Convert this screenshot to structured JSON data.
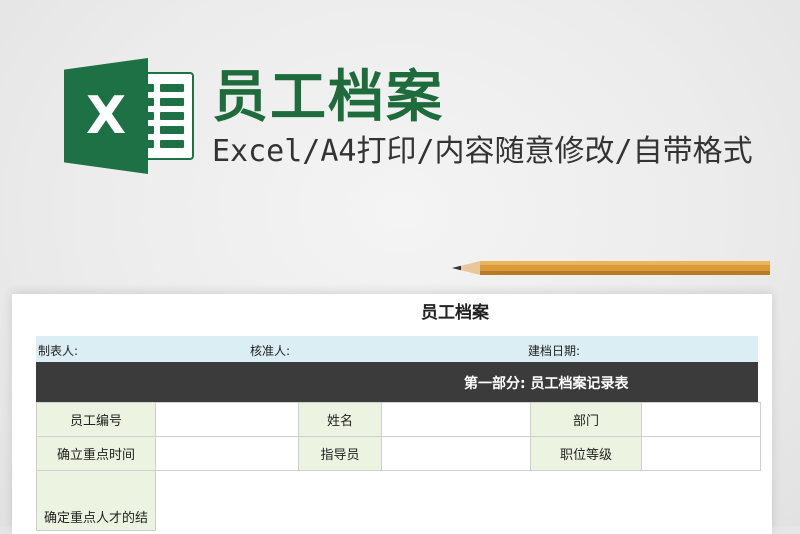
{
  "banner": {
    "title": "员工档案",
    "subtitle": "Excel/A4打印/内容随意修改/自带格式",
    "logo_letter": "X",
    "brand_color": "#1e6b3c"
  },
  "sheet": {
    "title": "员工档案",
    "meta": {
      "maker_label": "制表人:",
      "reviewer_label": "核准人:",
      "date_label": "建档日期:"
    },
    "section_title": "第一部分: 员工档案记录表",
    "rows": [
      {
        "label1": "员工编号",
        "value1": "",
        "label2": "姓名",
        "value2": "",
        "label3": "部门",
        "value3": ""
      },
      {
        "label1": "确立重点时间",
        "value1": "",
        "label2": "指导员",
        "value2": "",
        "label3": "职位等级",
        "value3": ""
      },
      {
        "label1": "确定重点人才的结"
      }
    ]
  }
}
